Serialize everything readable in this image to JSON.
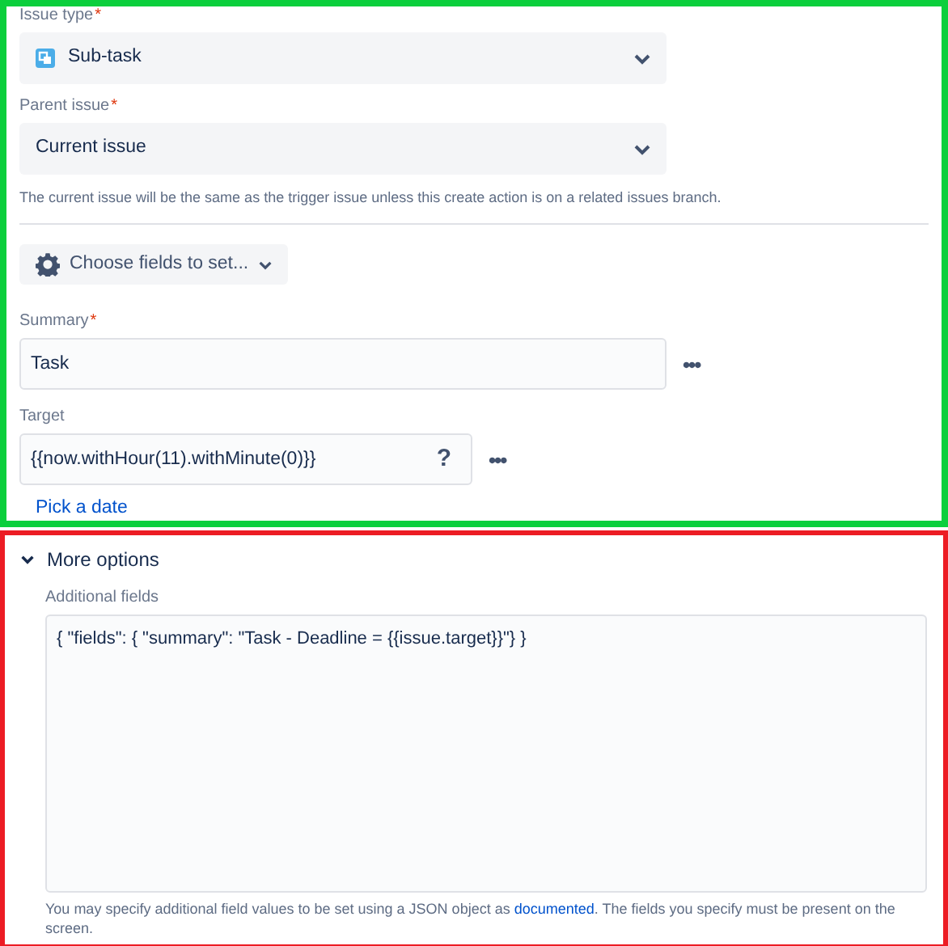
{
  "issue_type": {
    "label": "Issue type",
    "required_mark": "*",
    "value": "Sub-task"
  },
  "parent_issue": {
    "label": "Parent issue",
    "required_mark": "*",
    "value": "Current issue",
    "help": "The current issue will be the same as the trigger issue unless this create action is on a related issues branch."
  },
  "choose_fields_button": "Choose fields to set...",
  "summary": {
    "label": "Summary",
    "required_mark": "*",
    "value": "Task",
    "more_button": "•••"
  },
  "target": {
    "label": "Target",
    "value": "{{now.withHour(11).withMinute(0)}}",
    "help_button": "?",
    "more_button": "•••",
    "link": "Pick a date"
  },
  "more_options": {
    "title": "More options",
    "expanded": true,
    "field_label": "Additional fields",
    "value": "{ \"fields\": { \"summary\": \"Task - Deadline = {{issue.target}}\"} }",
    "help_before": "You may specify additional field values to be set using a JSON object as",
    "help_link": "documented",
    "help_after": ". The fields you specify must be present on the screen."
  }
}
